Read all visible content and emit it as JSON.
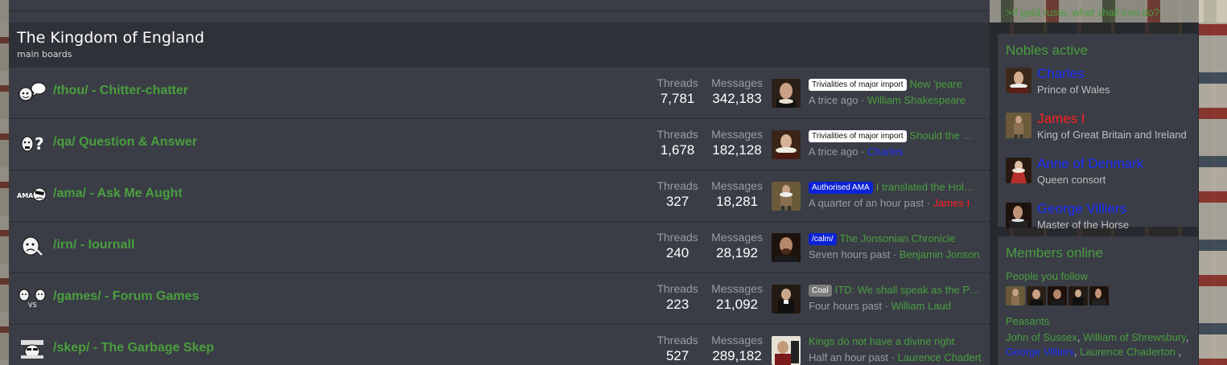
{
  "category": {
    "title": "The Kingdom of England",
    "description": "main boards"
  },
  "stat_labels": {
    "threads": "Threads",
    "messages": "Messages"
  },
  "nodes": [
    {
      "icon": "speech-bubble-faces-icon",
      "title": "/thou/ - Chitter-chatter",
      "threads": "7,781",
      "messages": "342,183",
      "prefix": "Trivialities of major import",
      "last_title": "New 'peare",
      "time": "A trice ago",
      "user": "William Shakespeare"
    },
    {
      "icon": "question-face-icon",
      "title": "/qa/ Question & Answer",
      "threads": "1,678",
      "messages": "182,128",
      "prefix": "Trivialities of major import",
      "last_title": "Should the …",
      "time": "A trice ago",
      "user": "Charles"
    },
    {
      "icon": "ama-face-icon",
      "icon_text": "AMA",
      "title": "/ama/ - Ask Me Aught",
      "threads": "327",
      "messages": "18,281",
      "prefix": "Authorised AMA",
      "last_title": "I translated the Hol…",
      "time": "A quarter of an hour past",
      "user": "James I"
    },
    {
      "icon": "sad-face-icon",
      "title": "/irn/ - Iournall",
      "threads": "240",
      "messages": "28,192",
      "prefix": "/calm/",
      "last_title": "The Jonsonian Chronicle",
      "time": "Seven hours past",
      "user": "Benjamin Jonson"
    },
    {
      "icon": "versus-faces-icon",
      "icon_text": "VS",
      "title": "/games/ - Forum Games",
      "threads": "223",
      "messages": "21,092",
      "prefix": "Coal",
      "last_title": "ITD: We shall speak as the Pur…",
      "time": "Four hours past",
      "user": "William Laud"
    },
    {
      "icon": "garbage-face-icon",
      "title": "/skep/ - The Garbage Skep",
      "threads": "527",
      "messages": "289,182",
      "prefix": "",
      "last_title": "Kings do not have a divine right",
      "time": "Half an hour past",
      "user": "Laurence Chaderton"
    }
  ],
  "sidebar": {
    "quote": ">If gold ruste, what shall iron do?",
    "nobles": {
      "title": "Nobles active",
      "items": [
        {
          "name": "Charles",
          "role": "Prince of Wales",
          "color": "#1d2fff"
        },
        {
          "name": "James I",
          "role": "King of Great Britain and Ireland",
          "color": "#ff2020"
        },
        {
          "name": "Anne of Denmark",
          "role": "Queen consort",
          "color": "#1d2fff"
        },
        {
          "name": "George Villiers",
          "role": "Master of the Horse",
          "color": "#1d2fff"
        }
      ]
    },
    "members": {
      "title": "Members online",
      "follow_label": "People you follow",
      "follow_count": 5,
      "peasants_label": "Peasants",
      "peasants": [
        {
          "name": "John of Sussex",
          "sep": ", "
        },
        {
          "name": "William of Shrewsbury",
          "sep": ", "
        },
        {
          "name": "George Villiers",
          "sep": ", "
        },
        {
          "name": "Laurence Chaderton",
          "sep": " ,"
        }
      ]
    }
  }
}
